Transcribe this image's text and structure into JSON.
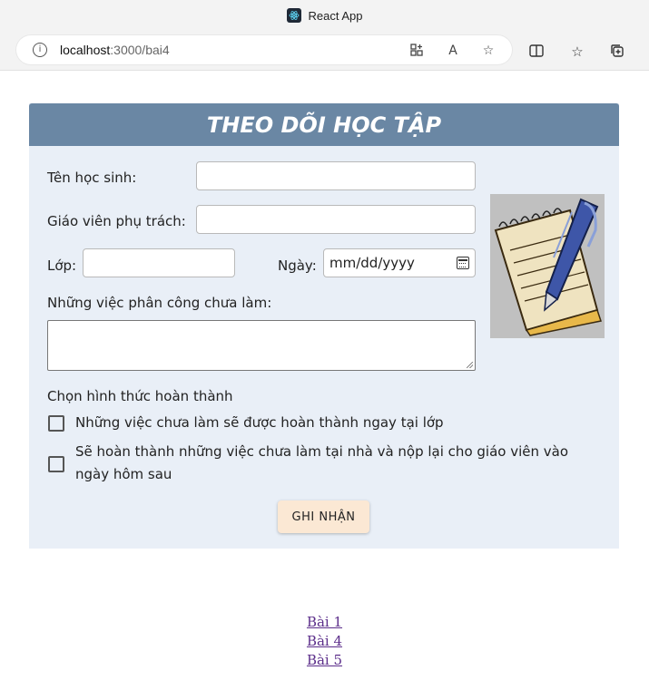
{
  "browser": {
    "tab_title": "React App",
    "url_host": "localhost",
    "url_path": ":3000/bai4",
    "icons": [
      "react-icon",
      "info-icon",
      "apps-icon",
      "read-aloud-icon",
      "favorite-star-icon",
      "split-screen-icon",
      "favorites-icon",
      "collections-icon"
    ]
  },
  "form": {
    "title": "THEO DÕI HỌC TẬP",
    "student_name_label": "Tên học sinh:",
    "student_name_value": "",
    "teacher_label": "Giáo viên phụ trách:",
    "teacher_value": "",
    "class_label": "Lớp:",
    "class_value": "",
    "date_label": "Ngày:",
    "date_placeholder": "mm/dd/yyyy",
    "tasks_label": "Những việc phân công chưa làm:",
    "tasks_value": "",
    "completion_label": "Chọn hình thức hoàn thành",
    "options": [
      {
        "label": "Những việc chưa làm sẽ được hoàn thành ngay tại lớp",
        "checked": false
      },
      {
        "label": "Sẽ hoàn thành những việc chưa làm tại nhà và nộp lại cho giáo viên vào ngày hôm sau",
        "checked": false
      }
    ],
    "submit_label": "GHI NHẬN",
    "illustration_icon": "notepad-pen-icon"
  },
  "nav_links": [
    "Bài 1",
    "Bài 4",
    "Bài 5"
  ],
  "colors": {
    "header_bg": "#6a87a4",
    "panel_bg": "#e9eff7",
    "button_bg": "#fbe8d4",
    "link": "#5b2d8a"
  }
}
